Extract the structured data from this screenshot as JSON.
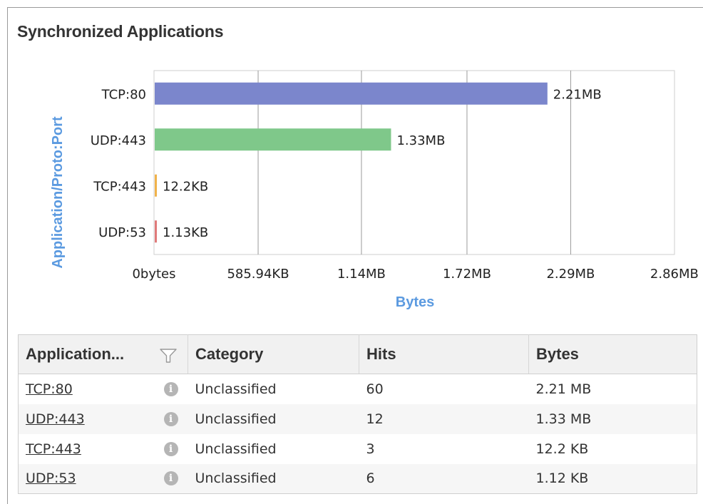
{
  "panel": {
    "title": "Synchronized Applications"
  },
  "chart_data": {
    "type": "bar",
    "orientation": "horizontal",
    "categories": [
      "TCP:80",
      "UDP:443",
      "TCP:443",
      "UDP:53"
    ],
    "values": [
      2210,
      1330,
      12.2,
      1.13
    ],
    "value_unit": "KB",
    "value_labels": [
      "2.21MB",
      "1.33MB",
      "12.2KB",
      "1.13KB"
    ],
    "colors": [
      "#7b86cc",
      "#7fc88a",
      "#f0b24a",
      "#e07a7a"
    ],
    "xlim": [
      0,
      2929
    ],
    "x_ticks": [
      {
        "value": 0,
        "label": "0bytes"
      },
      {
        "value": 585.94,
        "label": "585.94KB"
      },
      {
        "value": 1167.36,
        "label": "1.14MB"
      },
      {
        "value": 1761.28,
        "label": "1.72MB"
      },
      {
        "value": 2344.96,
        "label": "2.29MB"
      },
      {
        "value": 2928.64,
        "label": "2.86MB"
      }
    ],
    "xlabel": "Bytes",
    "ylabel": "Application/Proto:Port",
    "grid": true
  },
  "table": {
    "columns": [
      "Application...",
      "Category",
      "Hits",
      "Bytes"
    ],
    "filter_icon": "funnel-icon",
    "info_icon": "info-icon",
    "rows": [
      {
        "application": "TCP:80",
        "category": "Unclassified",
        "hits": "60",
        "bytes": "2.21 MB"
      },
      {
        "application": "UDP:443",
        "category": "Unclassified",
        "hits": "12",
        "bytes": "1.33 MB"
      },
      {
        "application": "TCP:443",
        "category": "Unclassified",
        "hits": "3",
        "bytes": "12.2 KB"
      },
      {
        "application": "UDP:53",
        "category": "Unclassified",
        "hits": "6",
        "bytes": "1.12 KB"
      }
    ]
  }
}
